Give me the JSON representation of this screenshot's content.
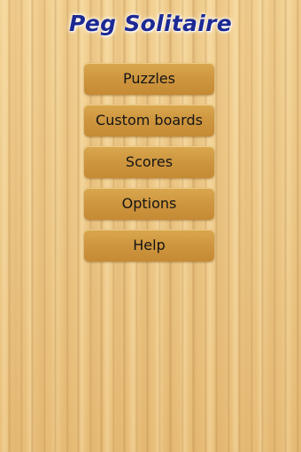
{
  "app": {
    "title": "Peg Solitaire"
  },
  "menu": {
    "items": [
      {
        "label": "Puzzles"
      },
      {
        "label": "Custom boards"
      },
      {
        "label": "Scores"
      },
      {
        "label": "Options"
      },
      {
        "label": "Help"
      }
    ]
  },
  "colors": {
    "title": "#1d2a93",
    "button": "#cf9740",
    "background": "#efcd8c"
  }
}
